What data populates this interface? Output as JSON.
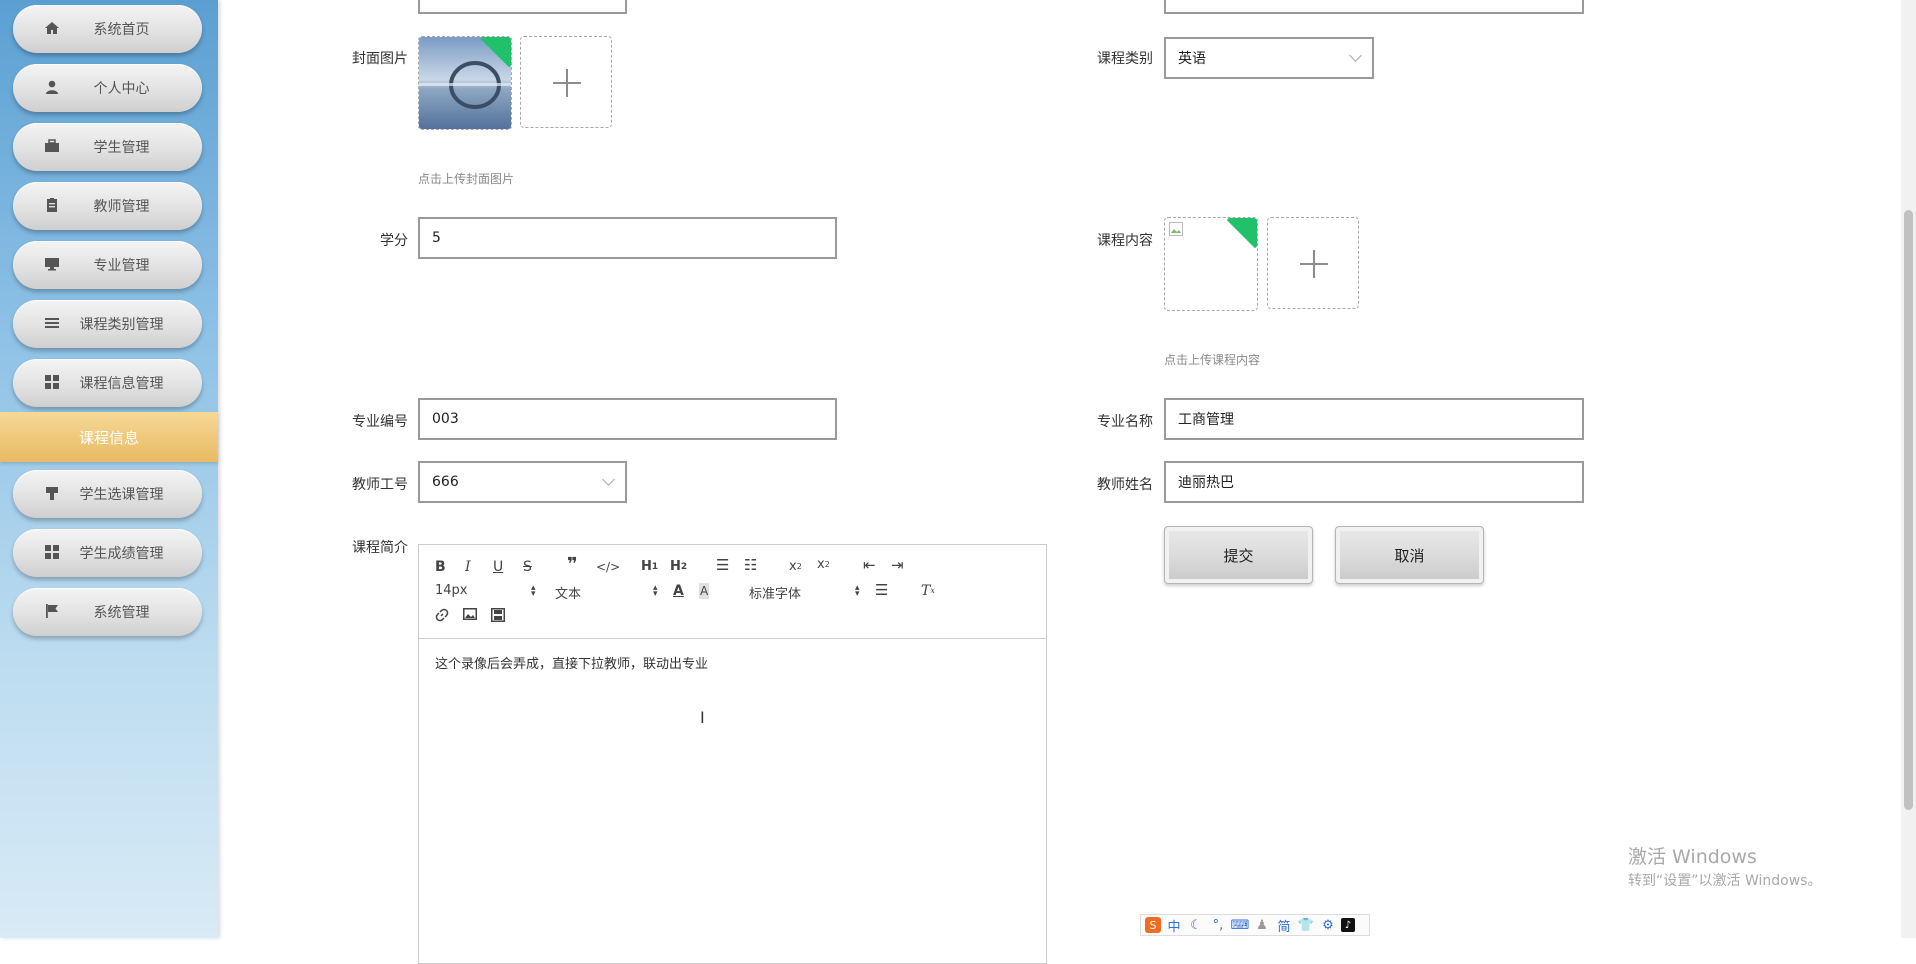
{
  "sidebar": {
    "items": [
      {
        "label": "系统首页",
        "icon": "home-icon"
      },
      {
        "label": "个人中心",
        "icon": "user-icon"
      },
      {
        "label": "学生管理",
        "icon": "briefcase-icon"
      },
      {
        "label": "教师管理",
        "icon": "clipboard-icon"
      },
      {
        "label": "专业管理",
        "icon": "monitor-icon"
      },
      {
        "label": "课程类别管理",
        "icon": "list-icon"
      },
      {
        "label": "课程信息管理",
        "icon": "grid-icon"
      },
      {
        "label": "学生选课管理",
        "icon": "stamp-icon"
      },
      {
        "label": "学生成绩管理",
        "icon": "grid-icon"
      },
      {
        "label": "系统管理",
        "icon": "flag-icon"
      }
    ],
    "active_sub": "课程信息"
  },
  "form": {
    "cover_label": "封面图片",
    "cover_hint": "点击上传封面图片",
    "category_label": "课程类别",
    "category_value": "英语",
    "credit_label": "学分",
    "credit_value": "5",
    "content_label": "课程内容",
    "content_hint": "点击上传课程内容",
    "major_no_label": "专业编号",
    "major_no_value": "003",
    "major_name_label": "专业名称",
    "major_name_value": "工商管理",
    "teacher_no_label": "教师工号",
    "teacher_no_value": "666",
    "teacher_name_label": "教师姓名",
    "teacher_name_value": "迪丽热巴",
    "intro_label": "课程简介"
  },
  "editor": {
    "font_size": "14px",
    "text_type": "文本",
    "font_family": "标准字体",
    "content": "这个录像后会弄成，直接下拉教师，联动出专业"
  },
  "buttons": {
    "submit": "提交",
    "cancel": "取消"
  },
  "watermark": {
    "line1": "激活 Windows",
    "line2": "转到“设置”以激活 Windows。"
  },
  "ime": {
    "zhong": "中",
    "jian": "简"
  },
  "colors": {
    "sidebar_top": "#5b9fd2",
    "active_sub": "#e8bb62",
    "upload_success": "#21c16b"
  }
}
